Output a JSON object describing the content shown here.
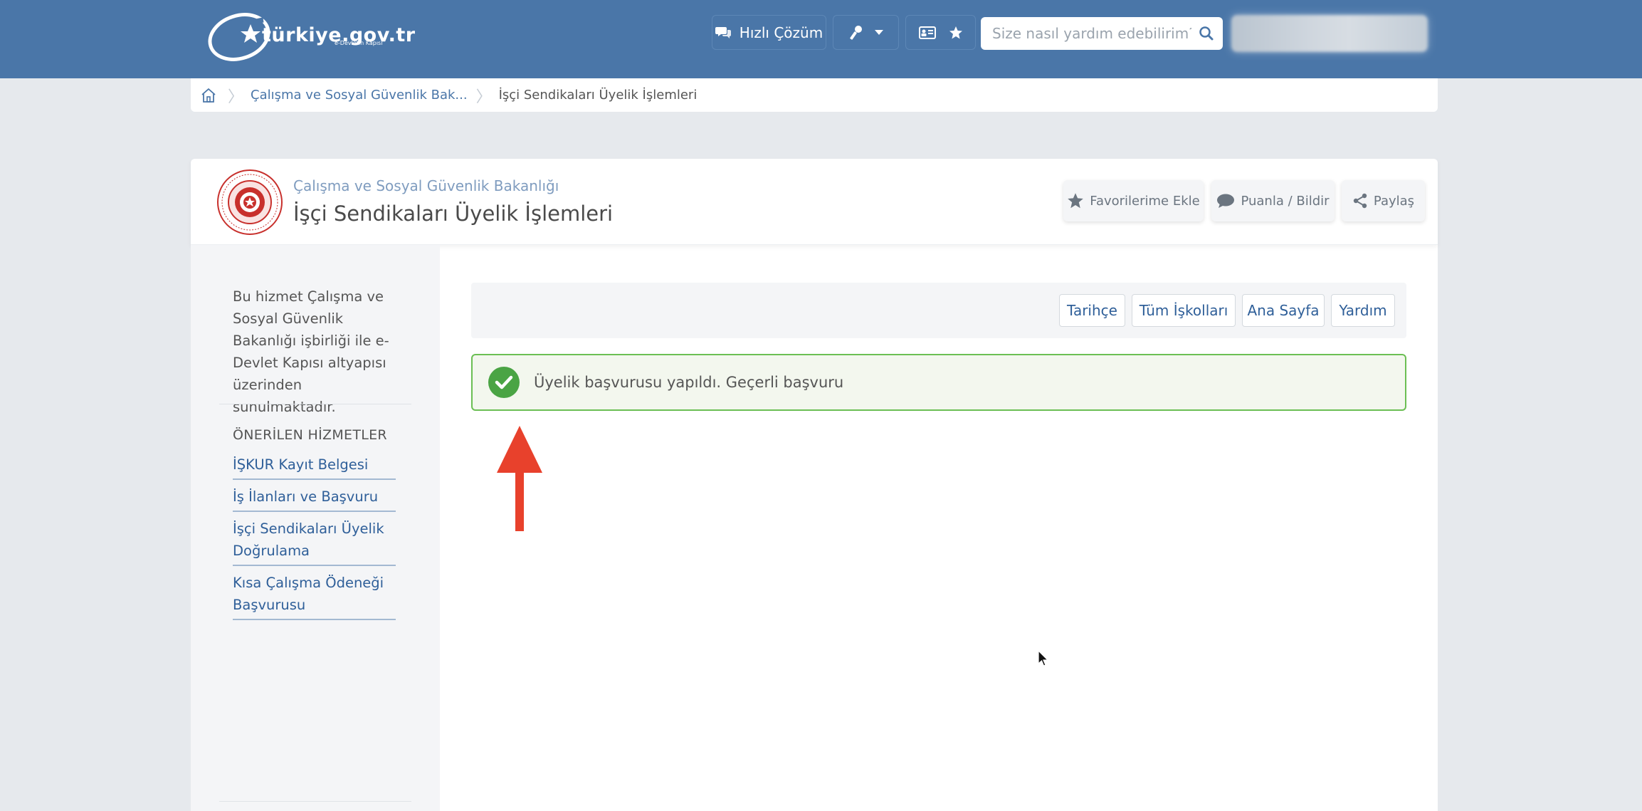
{
  "header": {
    "logo_text": "türkiye.gov.tr",
    "logo_slogan": "e-Devletin Kapısı",
    "hizli_cozum_label": "Hızlı Çözüm",
    "search_placeholder": "Size nasıl yardım edebilirim?"
  },
  "breadcrumb": {
    "items": [
      "Çalışma ve Sosyal Güvenlik Bak...",
      "İşçi Sendikaları Üyelik İşlemleri"
    ]
  },
  "page": {
    "ministry": "Çalışma ve Sosyal Güvenlik Bakanlığı",
    "title": "İşçi Sendikaları Üyelik İşlemleri",
    "actions": {
      "favorite": "Favorilerime Ekle",
      "rate": "Puanla / Bildir",
      "share": "Paylaş"
    }
  },
  "sidebar": {
    "info": "Bu hizmet Çalışma ve Sosyal Güvenlik Bakanlığı işbirliği ile e-Devlet Kapısı altyapısı üzerinden sunulmaktadır.",
    "heading": "ÖNERİLEN HİZMETLER",
    "links": [
      "İŞKUR Kayıt Belgesi",
      "İş İlanları ve Başvuru",
      "İşçi Sendikaları Üyelik Doğrulama",
      "Kısa Çalışma Ödeneği Başvurusu"
    ]
  },
  "toolbar": {
    "buttons": [
      "Tarihçe",
      "Tüm İşkolları",
      "Ana Sayfa",
      "Yardım"
    ]
  },
  "alert": {
    "message": "Üyelik başvurusu yapıldı. Geçerli başvuru",
    "status": "success",
    "color": "#6bbf54"
  },
  "colors": {
    "brand": "#4a76a8",
    "link": "#2f5f99",
    "annotation_arrow": "#e8412c"
  }
}
